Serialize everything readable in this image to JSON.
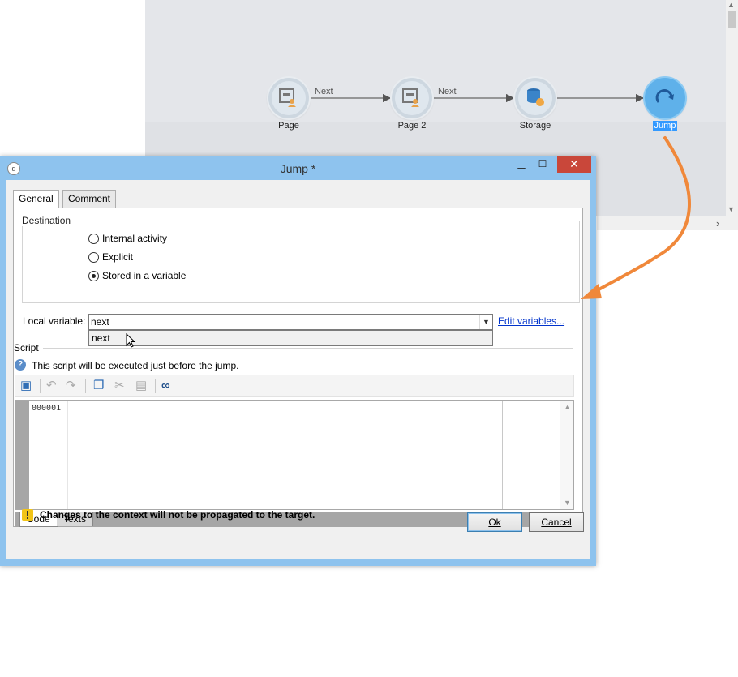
{
  "workflow": {
    "nodes": [
      {
        "label": "Page",
        "icon": "page-icon"
      },
      {
        "label": "Page 2",
        "icon": "page-icon"
      },
      {
        "label": "Storage",
        "icon": "storage-icon"
      },
      {
        "label": "Jump",
        "icon": "jump-icon",
        "selected": true
      }
    ],
    "transitions": [
      "Next",
      "Next"
    ]
  },
  "dialog": {
    "title": "Jump *",
    "tabs": [
      "General",
      "Comment"
    ],
    "destination": {
      "legend": "Destination",
      "options": [
        "Internal activity",
        "Explicit",
        "Stored in a variable"
      ],
      "selected": "Stored in a variable"
    },
    "local_variable": {
      "label": "Local variable:",
      "value": "next",
      "list_items": [
        "next"
      ]
    },
    "edit_variables_link": "Edit variables...",
    "script": {
      "legend": "Script",
      "help": "This script will be executed just before the jump.",
      "line_number": "000001",
      "bottom_tabs": [
        "Code",
        "Texts"
      ]
    },
    "warning": "Changes to the context will not be propagated to the target.",
    "buttons": {
      "ok": "Ok",
      "cancel": "Cancel"
    }
  },
  "colors": {
    "accent": "#3399ff",
    "arrow": "#f0883a",
    "titlebar": "#8ec3ee",
    "close": "#c9473a"
  }
}
